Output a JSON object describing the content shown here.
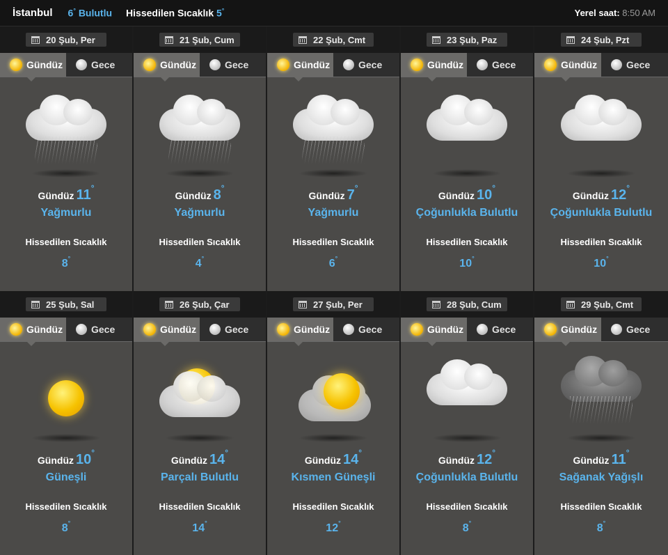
{
  "header": {
    "city": "İstanbul",
    "current_temp": "6",
    "current_condition": "Bulutlu",
    "feels_label": "Hissedilen Sıcaklık",
    "feels_value": "5",
    "local_time_label": "Yerel saat:",
    "local_time": "8:50 AM",
    "degree_symbol": "°"
  },
  "tabs": {
    "day_label": "Gündüz",
    "night_label": "Gece"
  },
  "colors": {
    "accent": "#5ab4ec",
    "card_bg": "#4b4a48",
    "topbar_bg": "#141414"
  },
  "days": [
    {
      "date": "20 Şub, Per",
      "day_prefix": "Gündüz",
      "temp": "11",
      "condition": "Yağmurlu",
      "feels_label": "Hissedilen Sıcaklık",
      "feels": "8",
      "icon": "rain-cloud-icon"
    },
    {
      "date": "21 Şub, Cum",
      "day_prefix": "Gündüz",
      "temp": "8",
      "condition": "Yağmurlu",
      "feels_label": "Hissedilen Sıcaklık",
      "feels": "4",
      "icon": "rain-cloud-icon"
    },
    {
      "date": "22 Şub, Cmt",
      "day_prefix": "Gündüz",
      "temp": "7",
      "condition": "Yağmurlu",
      "feels_label": "Hissedilen Sıcaklık",
      "feels": "6",
      "icon": "rain-cloud-icon"
    },
    {
      "date": "23 Şub, Paz",
      "day_prefix": "Gündüz",
      "temp": "10",
      "condition": "Çoğunlukla Bulutlu",
      "feels_label": "Hissedilen Sıcaklık",
      "feels": "10",
      "icon": "cloud-icon"
    },
    {
      "date": "24 Şub, Pzt",
      "day_prefix": "Gündüz",
      "temp": "12",
      "condition": "Çoğunlukla Bulutlu",
      "feels_label": "Hissedilen Sıcaklık",
      "feels": "10",
      "icon": "cloud-icon"
    },
    {
      "date": "25 Şub, Sal",
      "day_prefix": "Gündüz",
      "temp": "10",
      "condition": "Güneşli",
      "feels_label": "Hissedilen Sıcaklık",
      "feels": "8",
      "icon": "sun-icon"
    },
    {
      "date": "26 Şub, Çar",
      "day_prefix": "Gündüz",
      "temp": "14",
      "condition": "Parçalı Bulutlu",
      "feels_label": "Hissedilen Sıcaklık",
      "feels": "14",
      "icon": "partly-cloudy-icon"
    },
    {
      "date": "27 Şub, Per",
      "day_prefix": "Gündüz",
      "temp": "14",
      "condition": "Kısmen Güneşli",
      "feels_label": "Hissedilen Sıcaklık",
      "feels": "12",
      "icon": "partly-sunny-icon"
    },
    {
      "date": "28 Şub, Cum",
      "day_prefix": "Gündüz",
      "temp": "12",
      "condition": "Çoğunlukla Bulutlu",
      "feels_label": "Hissedilen Sıcaklık",
      "feels": "8",
      "icon": "cloud-icon"
    },
    {
      "date": "29 Şub, Cmt",
      "day_prefix": "Gündüz",
      "temp": "11",
      "condition": "Sağanak Yağışlı",
      "feels_label": "Hissedilen Sıcaklık",
      "feels": "8",
      "icon": "shower-cloud-icon"
    }
  ]
}
